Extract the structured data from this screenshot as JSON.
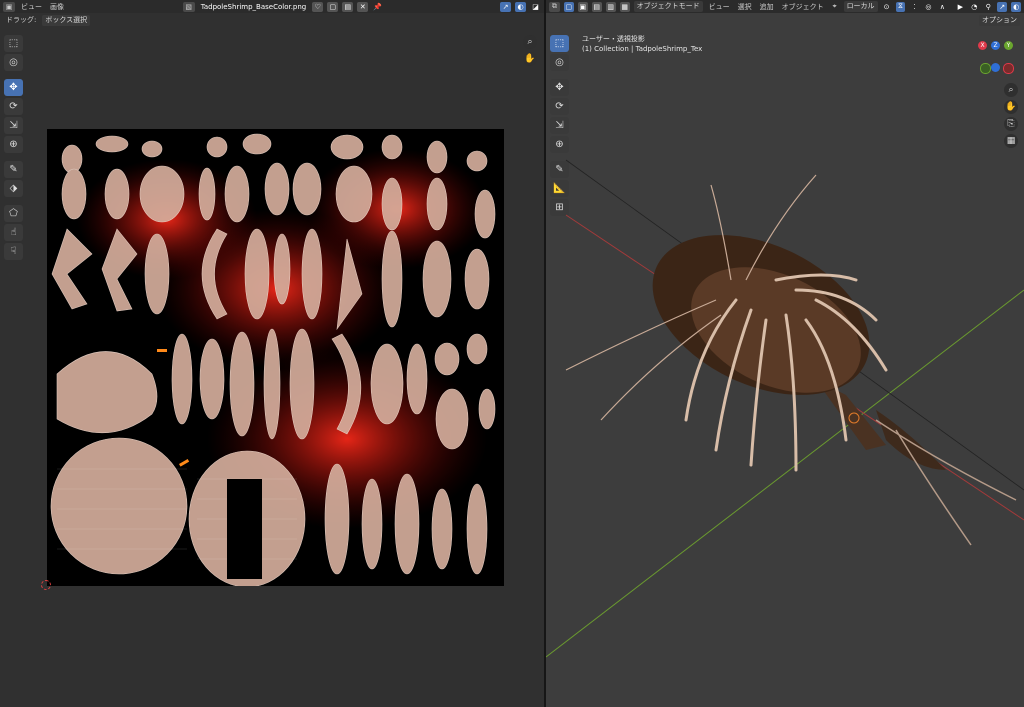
{
  "uv_editor": {
    "editor_icon": "image-editor-icon",
    "menus": [
      "ビュー",
      "画像"
    ],
    "image_name": "TadpoleShrimp_BaseColor.png",
    "drag_label": "ドラッグ:",
    "drag_mode": "ボックス選択",
    "tools": [
      "select-box-icon",
      "cursor-icon",
      "move-icon",
      "rotate-icon",
      "scale-icon",
      "transform-icon",
      "annotate-icon",
      "rip-icon",
      "grab-icon",
      "relax-icon",
      "pinch-icon"
    ]
  },
  "viewport": {
    "mode": "オブジェクトモード",
    "menus": [
      "ビュー",
      "選択",
      "追加",
      "オブジェクト"
    ],
    "transform_orientation": "ローカル",
    "options_label": "オプション",
    "view_name": "ユーザー・透視投影",
    "collection_info": "(1) Collection | TadpoleShrimp_Tex",
    "gizmo_axes": [
      {
        "label": "X",
        "color": "#e0394a"
      },
      {
        "label": "Y",
        "color": "#6aa52e"
      },
      {
        "label": "Z",
        "color": "#2f6fd6"
      }
    ],
    "colors": {
      "accent": "#4772b3",
      "x_axis": "#a33a3a",
      "y_axis": "#6a9a2f"
    }
  }
}
